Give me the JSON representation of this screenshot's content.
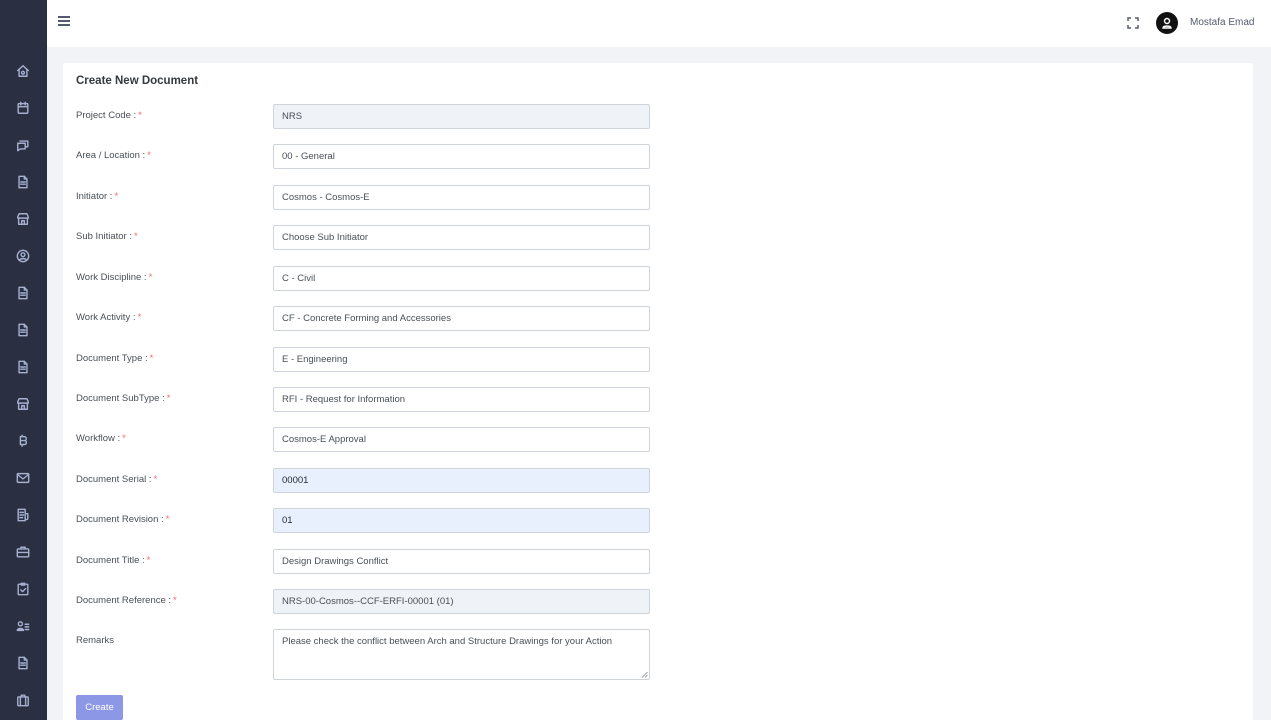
{
  "header": {
    "user_name": "Mostafa Emad"
  },
  "sidebar": {
    "icons": [
      "home-icon",
      "calendar-icon",
      "chat-icon",
      "file-icon",
      "store-icon",
      "user-circle-icon",
      "file-icon",
      "file-icon",
      "file-icon",
      "store-icon",
      "bitcoin-icon",
      "mail-icon",
      "receipt-icon",
      "briefcase-icon",
      "clipboard-check-icon",
      "user-list-icon",
      "file-icon",
      "suitcase-icon"
    ]
  },
  "form": {
    "title": "Create New Document",
    "required_mark": "*",
    "fields": [
      {
        "label": "Project Code :",
        "required": true,
        "value": "NRS",
        "state": "readonly"
      },
      {
        "label": "Area / Location :",
        "required": true,
        "value": "00 - General",
        "state": "select"
      },
      {
        "label": "Initiator :",
        "required": true,
        "value": "Cosmos - Cosmos-E",
        "state": "select"
      },
      {
        "label": "Sub Initiator :",
        "required": true,
        "value": "Choose Sub Initiator",
        "state": "select"
      },
      {
        "label": "Work Discipline :",
        "required": true,
        "value": "C - Civil",
        "state": "select"
      },
      {
        "label": "Work Activity :",
        "required": true,
        "value": "CF - Concrete Forming and Accessories",
        "state": "select"
      },
      {
        "label": "Document Type :",
        "required": true,
        "value": "E - Engineering",
        "state": "select"
      },
      {
        "label": "Document SubType :",
        "required": true,
        "value": "RFI - Request for Information",
        "state": "select"
      },
      {
        "label": "Workflow :",
        "required": true,
        "value": "Cosmos-E Approval",
        "state": "select"
      },
      {
        "label": "Document Serial :",
        "required": true,
        "value": "00001",
        "state": "autofill"
      },
      {
        "label": "Document Revision :",
        "required": true,
        "value": "01",
        "state": "autofill"
      },
      {
        "label": "Document Title :",
        "required": true,
        "value": "Design Drawings Conflict",
        "state": "input"
      },
      {
        "label": "Document Reference :",
        "required": true,
        "value": "NRS-00-Cosmos--CCF-ERFI-00001 (01)",
        "state": "readonly"
      },
      {
        "label": "Remarks",
        "required": false,
        "value": "Please check the conflict between Arch and Structure Drawings for your Action",
        "state": "textarea"
      }
    ],
    "submit_label": "Create"
  },
  "colors": {
    "sidebar_bg": "#2a3042",
    "page_bg": "#f2f3f6",
    "required": "#f46a6a",
    "button": "#8c97e6",
    "readonly_bg": "#eff2f7",
    "autofill_bg": "#e8f0fe"
  }
}
